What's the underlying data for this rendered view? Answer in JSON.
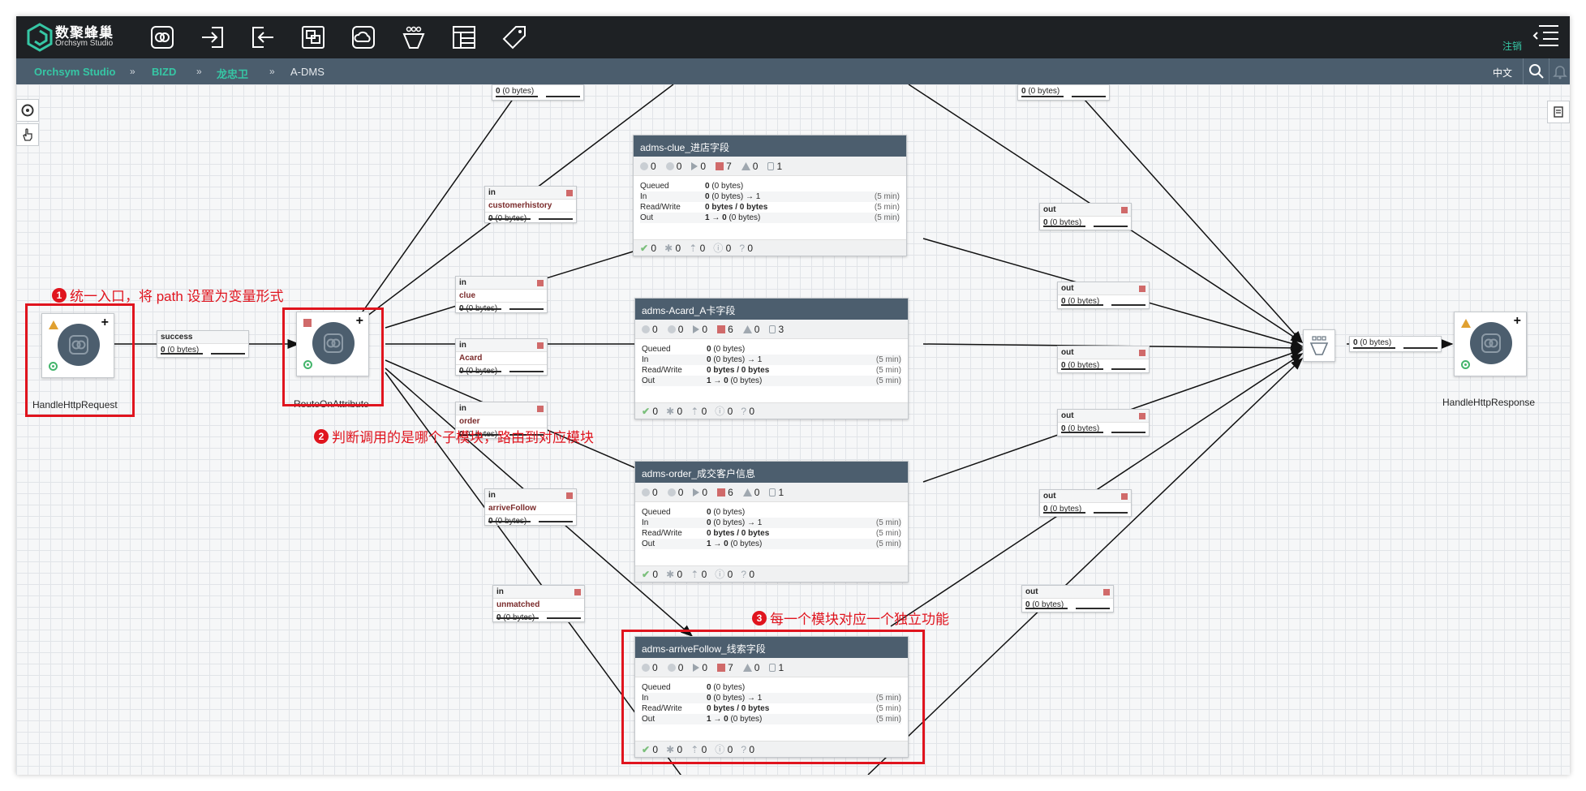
{
  "header": {
    "brand_title": "数聚蜂巢",
    "brand_subtitle": "Orchsym Studio",
    "logout_label": "注销",
    "toolbar_icons": [
      "processor-icon",
      "input-port-icon",
      "output-port-icon",
      "process-group-icon",
      "remote-group-icon",
      "funnel-icon",
      "template-icon",
      "label-icon"
    ]
  },
  "breadcrumb": {
    "items": [
      "Orchsym Studio",
      "BIZD",
      "龙忠卫",
      "A-DMS"
    ],
    "separator": "»",
    "language": "中文"
  },
  "processors": {
    "request": {
      "name": "HandleHttpRequest"
    },
    "route": {
      "name": "RouteOnAttribute"
    },
    "response": {
      "name": "HandleHttpResponse"
    }
  },
  "connections": {
    "success": {
      "name": "success",
      "queued": "0",
      "bytes": "(0 bytes)"
    },
    "top_left": {
      "queued": "0",
      "bytes": "(0 bytes)"
    },
    "top_right": {
      "queued": "0",
      "bytes": "(0 bytes)"
    },
    "in_customerhistory": {
      "dir": "in",
      "name": "customerhistory",
      "queued": "0",
      "bytes": "(0 bytes)"
    },
    "in_clue": {
      "dir": "in",
      "name": "clue",
      "queued": "0",
      "bytes": "(0 bytes)"
    },
    "in_acard": {
      "dir": "in",
      "name": "Acard",
      "queued": "0",
      "bytes": "(0 bytes)"
    },
    "in_order": {
      "dir": "in",
      "name": "order",
      "queued": "0",
      "bytes": "(0 bytes)"
    },
    "in_arrivefollow": {
      "dir": "in",
      "name": "arriveFollow",
      "queued": "0",
      "bytes": "(0 bytes)"
    },
    "in_unmatched": {
      "dir": "in",
      "name": "unmatched",
      "queued": "0",
      "bytes": "(0 bytes)"
    },
    "out1": {
      "name": "out",
      "queued": "0",
      "bytes": "(0 bytes)"
    },
    "out2": {
      "name": "out",
      "queued": "0",
      "bytes": "(0 bytes)"
    },
    "out3": {
      "name": "out",
      "queued": "0",
      "bytes": "(0 bytes)"
    },
    "out4": {
      "name": "out",
      "queued": "0",
      "bytes": "(0 bytes)"
    },
    "out5": {
      "name": "out",
      "queued": "0",
      "bytes": "(0 bytes)"
    },
    "out6": {
      "name": "out",
      "queued": "0",
      "bytes": "(0 bytes)"
    },
    "funnel_out": {
      "queued": "0",
      "bytes": "(0 bytes)"
    }
  },
  "process_groups": [
    {
      "title": "adms-clue_进店字段",
      "stats": {
        "transmitting": "0",
        "not_transmitting": "0",
        "running": "0",
        "stopped": "7",
        "invalid": "0",
        "disabled": "1"
      },
      "rows": {
        "queued_label": "Queued",
        "queued_value": "0",
        "queued_bytes": "(0 bytes)",
        "in_label": "In",
        "in_value": "0",
        "in_detail": "(0 bytes) → 1",
        "in_time": "(5 min)",
        "rw_label": "Read/Write",
        "rw_value": "0 bytes / 0 bytes",
        "rw_time": "(5 min)",
        "out_label": "Out",
        "out_value": "1 → 0",
        "out_detail": "(0 bytes)",
        "out_time": "(5 min)"
      },
      "footer": {
        "up_to_date": "0",
        "modified": "0",
        "stale": "0",
        "locally_modified_stale": "0",
        "sync_failure": "0"
      }
    },
    {
      "title": "adms-Acard_A卡字段",
      "stats": {
        "transmitting": "0",
        "not_transmitting": "0",
        "running": "0",
        "stopped": "6",
        "invalid": "0",
        "disabled": "3"
      },
      "rows": {
        "queued_label": "Queued",
        "queued_value": "0",
        "queued_bytes": "(0 bytes)",
        "in_label": "In",
        "in_value": "0",
        "in_detail": "(0 bytes) → 1",
        "in_time": "(5 min)",
        "rw_label": "Read/Write",
        "rw_value": "0 bytes / 0 bytes",
        "rw_time": "(5 min)",
        "out_label": "Out",
        "out_value": "1 → 0",
        "out_detail": "(0 bytes)",
        "out_time": "(5 min)"
      },
      "footer": {
        "up_to_date": "0",
        "modified": "0",
        "stale": "0",
        "locally_modified_stale": "0",
        "sync_failure": "0"
      }
    },
    {
      "title": "adms-order_成交客户信息",
      "stats": {
        "transmitting": "0",
        "not_transmitting": "0",
        "running": "0",
        "stopped": "6",
        "invalid": "0",
        "disabled": "1"
      },
      "rows": {
        "queued_label": "Queued",
        "queued_value": "0",
        "queued_bytes": "(0 bytes)",
        "in_label": "In",
        "in_value": "0",
        "in_detail": "(0 bytes) → 1",
        "in_time": "(5 min)",
        "rw_label": "Read/Write",
        "rw_value": "0 bytes / 0 bytes",
        "rw_time": "(5 min)",
        "out_label": "Out",
        "out_value": "1 → 0",
        "out_detail": "(0 bytes)",
        "out_time": "(5 min)"
      },
      "footer": {
        "up_to_date": "0",
        "modified": "0",
        "stale": "0",
        "locally_modified_stale": "0",
        "sync_failure": "0"
      }
    },
    {
      "title": "adms-arriveFollow_线索字段",
      "stats": {
        "transmitting": "0",
        "not_transmitting": "0",
        "running": "0",
        "stopped": "7",
        "invalid": "0",
        "disabled": "1"
      },
      "rows": {
        "queued_label": "Queued",
        "queued_value": "0",
        "queued_bytes": "(0 bytes)",
        "in_label": "In",
        "in_value": "0",
        "in_detail": "(0 bytes) → 1",
        "in_time": "(5 min)",
        "rw_label": "Read/Write",
        "rw_value": "0 bytes / 0 bytes",
        "rw_time": "(5 min)",
        "out_label": "Out",
        "out_value": "1 → 0",
        "out_detail": "(0 bytes)",
        "out_time": "(5 min)"
      },
      "footer": {
        "up_to_date": "0",
        "modified": "0",
        "stale": "0",
        "locally_modified_stale": "0",
        "sync_failure": "0"
      }
    }
  ],
  "annotations": {
    "a1": {
      "num": "1",
      "text": "统一入口，将 path 设置为变量形式"
    },
    "a2": {
      "num": "2",
      "text": "判断调用的是哪个子模块，路由到对应模块"
    },
    "a3": {
      "num": "3",
      "text": "每一个模块对应一个独立功能"
    }
  },
  "colors": {
    "topbar": "#1e2124",
    "breadcrumb_bar": "#4b5d6d",
    "accent_green": "#36c7a5",
    "group_header": "#4c5e6e",
    "annotation_red": "#e0141e"
  }
}
